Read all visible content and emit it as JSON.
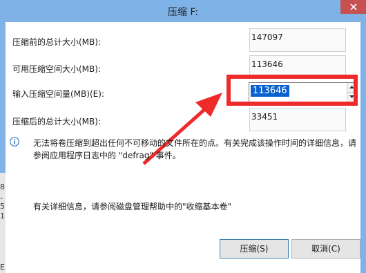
{
  "window": {
    "title": "压缩 F:"
  },
  "fields": {
    "before_label": "压缩前的总计大小(MB):",
    "before_value": "147097",
    "available_label": "可用压缩空间大小(MB):",
    "available_value": "113646",
    "amount_label": "输入压缩空间量(MB)(E):",
    "amount_value": "113646",
    "after_label": "压缩后的总计大小(MB):",
    "after_value": "33451"
  },
  "info": {
    "icon": "info-icon",
    "text": "无法将卷压缩到超出任何不可移动的文件所在的点。有关完成该操作时间的详细信息，请参阅应用程序日志中的 \"defrag\" 事件。"
  },
  "help": {
    "text": "有关详细信息，请参阅磁盘管理帮助中的\"收缩基本卷\""
  },
  "buttons": {
    "shrink": "压缩(S)",
    "cancel": "取消(C)"
  },
  "edge_chars": [
    "8",
    "-",
    "5",
    "1",
    "E"
  ],
  "colors": {
    "titlebar": "#7fb3e8",
    "close": "#c75050",
    "highlight": "#ee2a2a",
    "selection": "#0a62cf"
  }
}
